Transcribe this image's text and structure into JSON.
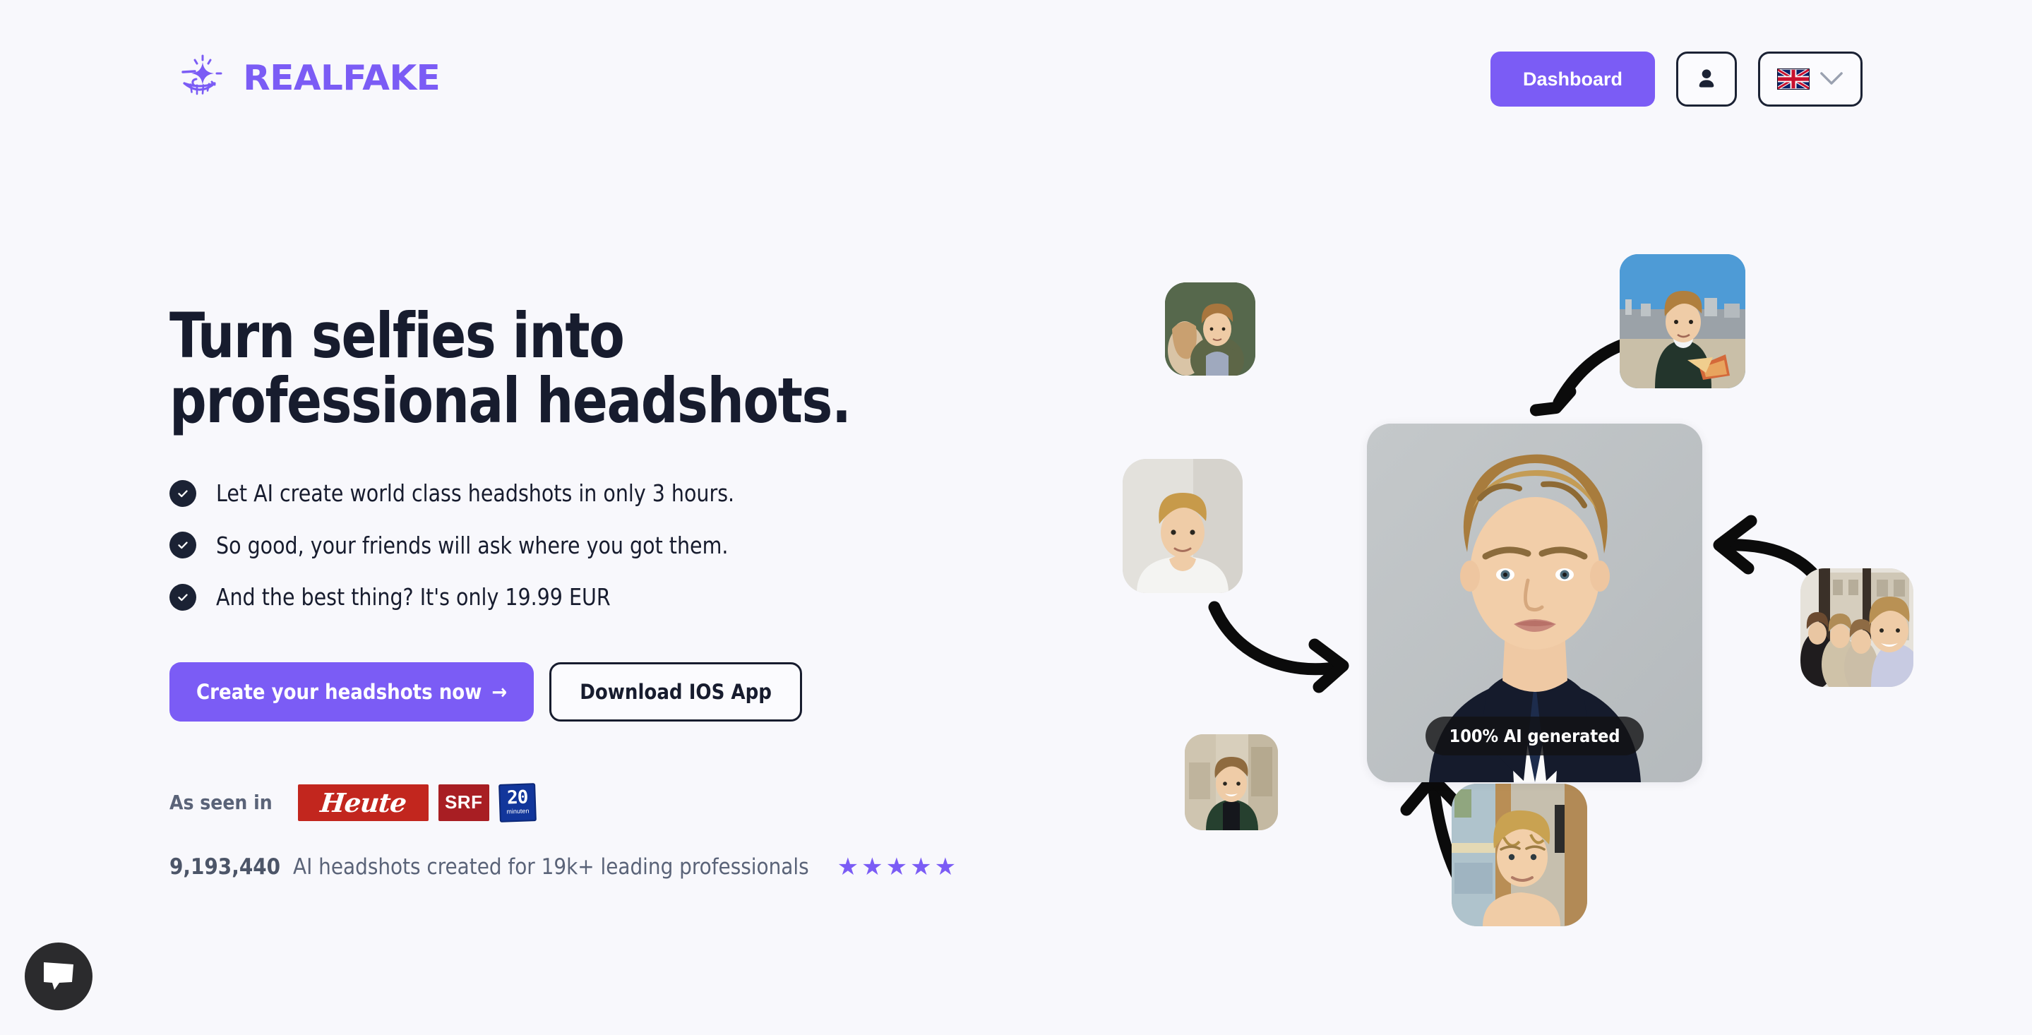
{
  "brand": {
    "name": "REALFAKE",
    "logo_icon": "sparkle-smile-icon",
    "accent_color": "#7B5CF5"
  },
  "header": {
    "dashboard_label": "Dashboard",
    "account_icon": "user-circle-icon",
    "language_flag": "uk-flag-icon",
    "language_chevron": "chevron-down-icon"
  },
  "hero": {
    "headline_line1": "Turn selfies into",
    "headline_line2": "professional headshots.",
    "bullets": [
      {
        "icon": "check-circle-icon",
        "text": "Let AI create world class headshots in only 3 hours."
      },
      {
        "icon": "check-circle-icon",
        "text": "So good, your friends will ask where you got them."
      },
      {
        "icon": "check-circle-icon",
        "text": "And the best thing? It's only 19.99 EUR"
      }
    ],
    "primary_cta": "Create your headshots now",
    "primary_cta_arrow": "→",
    "secondary_cta": "Download IOS App"
  },
  "press": {
    "label": "As seen in",
    "logos": [
      {
        "name": "heute-logo",
        "text": "Heute",
        "color": "#C2261E"
      },
      {
        "name": "srf-logo",
        "text": "SRF",
        "color": "#A81E23"
      },
      {
        "name": "20minuten-logo",
        "text": "20",
        "subtext": "minuten",
        "color": "#12369B"
      }
    ]
  },
  "stats": {
    "count": "9,193,440",
    "description": "AI headshots created for 19k+ leading professionals",
    "star_count": 5,
    "star_glyph": "★",
    "star_color": "#7B5CF5"
  },
  "collage": {
    "main_badge": "100% AI generated",
    "photos": [
      {
        "name": "photo-couple-green-wall",
        "alt": "Selfie of couple against green wall"
      },
      {
        "name": "photo-rooftop-pizza",
        "alt": "Man with pizza on rooftop terrace"
      },
      {
        "name": "photo-white-tshirt",
        "alt": "Selfie in white t-shirt against wall"
      },
      {
        "name": "photo-group-cafe",
        "alt": "Group selfie in a cafe"
      },
      {
        "name": "photo-green-jacket-indoor",
        "alt": "Man in green jacket indoors"
      },
      {
        "name": "photo-shirtless-hallway",
        "alt": "Selfie in a sunlit hallway"
      },
      {
        "name": "photo-main-headshot",
        "alt": "AI generated professional headshot in suit"
      }
    ],
    "arrows": [
      {
        "name": "arrow-top-down-left",
        "direction": "down-left"
      },
      {
        "name": "arrow-left-right",
        "direction": "right"
      },
      {
        "name": "arrow-right-left",
        "direction": "left"
      },
      {
        "name": "arrow-bottom-up",
        "direction": "up"
      }
    ]
  },
  "chat": {
    "icon": "chat-bubble-icon",
    "label": "Open chat"
  }
}
